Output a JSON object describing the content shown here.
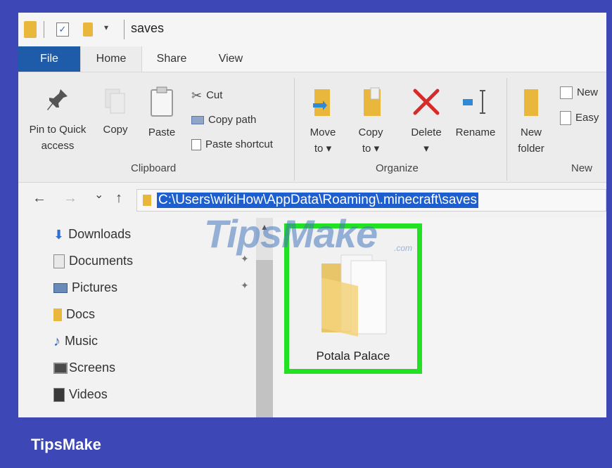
{
  "window": {
    "title": "saves",
    "quick_access_dropdown": "▾"
  },
  "tabs": [
    {
      "label": "File"
    },
    {
      "label": "Home"
    },
    {
      "label": "Share"
    },
    {
      "label": "View"
    }
  ],
  "ribbon": {
    "clipboard": {
      "pin_label_1": "Pin to Quick",
      "pin_label_2": "access",
      "copy_label": "Copy",
      "paste_label": "Paste",
      "cut_label": "Cut",
      "copy_path_label": "Copy path",
      "paste_shortcut_label": "Paste shortcut",
      "group_label": "Clipboard"
    },
    "organize": {
      "move_to_1": "Move",
      "move_to_2": "to ▾",
      "copy_to_1": "Copy",
      "copy_to_2": "to ▾",
      "delete_label": "Delete",
      "delete_drop": "▾",
      "rename_label": "Rename",
      "group_label": "Organize"
    },
    "new": {
      "new_folder_1": "New",
      "new_folder_2": "folder",
      "new_item_label": "New",
      "easy_access_label": "Easy",
      "group_label": "New"
    }
  },
  "navigation": {
    "back": "←",
    "forward": "→",
    "recent": "⌄",
    "up": "↑",
    "address": "C:\\Users\\wikiHow\\AppData\\Roaming\\.minecraft\\saves"
  },
  "sidebar": {
    "items": [
      {
        "label": "Downloads",
        "icon": "download-arrow-icon"
      },
      {
        "label": "Documents",
        "icon": "documents-icon"
      },
      {
        "label": "Pictures",
        "icon": "pictures-icon"
      },
      {
        "label": "Docs",
        "icon": "folder-icon"
      },
      {
        "label": "Music",
        "icon": "music-note-icon"
      },
      {
        "label": "Screens",
        "icon": "screens-icon"
      },
      {
        "label": "Videos",
        "icon": "videos-icon"
      }
    ],
    "pin_glyph": "📌"
  },
  "content": {
    "folders": [
      {
        "name": "Potala Palace",
        "selected": true
      }
    ]
  },
  "watermark": {
    "text": "TipsMake",
    "suffix": ".com"
  },
  "footer": {
    "brand": "TipsMake"
  },
  "colors": {
    "frame": "#3d48b6",
    "file_tab": "#1e5ba8",
    "selection_highlight": "#1e5fd0",
    "selection_box": "#22e022",
    "folder": "#e9b73c",
    "delete_red": "#d62b2b",
    "rename_blue": "#2e8ad8"
  }
}
